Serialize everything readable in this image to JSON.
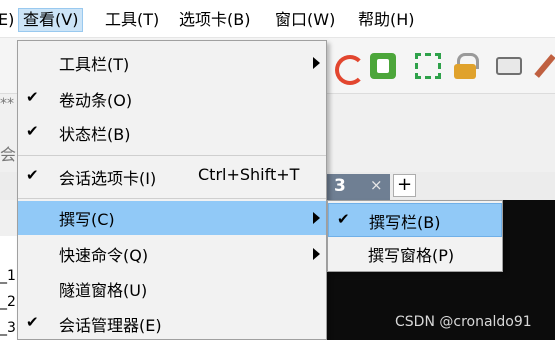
{
  "menubar": {
    "partial_left": "E)",
    "items": [
      {
        "label": "查看(V)",
        "active": true
      },
      {
        "label": "工具(T)"
      },
      {
        "label": "选项卡(B)"
      },
      {
        "label": "窗口(W)"
      },
      {
        "label": "帮助(H)"
      }
    ]
  },
  "toolbar": {
    "icons": [
      "swirl-icon",
      "green-app-icon",
      "fullscreen-icon",
      "lock-icon",
      "keyboard-icon",
      "pen-icon"
    ]
  },
  "background": {
    "frag_stars": "**",
    "frag_session": "会",
    "frag_rows": [
      "_1",
      "_2",
      "_3"
    ],
    "tab_number": "3",
    "tab_close": "×",
    "tab_add": "+"
  },
  "view_menu": {
    "items": [
      {
        "label": "工具栏(T)",
        "checked": false,
        "submenu": true
      },
      {
        "label": "卷动条(O)",
        "checked": true
      },
      {
        "label": "状态栏(B)",
        "checked": true
      },
      {
        "label": "会话选项卡(I)",
        "checked": true,
        "shortcut": "Ctrl+Shift+T"
      },
      {
        "label": "撰写(C)",
        "checked": false,
        "submenu": true,
        "highlighted": true
      },
      {
        "label": "快速命令(Q)",
        "checked": false,
        "submenu": true
      },
      {
        "label": "隧道窗格(U)",
        "checked": false
      },
      {
        "label": "会话管理器(E)",
        "checked": true
      }
    ],
    "check_glyph": "✔"
  },
  "compose_submenu": {
    "items": [
      {
        "label": "撰写栏(B)",
        "checked": true,
        "highlighted": true
      },
      {
        "label": "撰写窗格(P)",
        "checked": false
      }
    ]
  },
  "watermark": "CSDN @cronaldo91",
  "colors": {
    "highlight": "#91c9f7",
    "menubar_active": "#cce4f7",
    "menu_bg": "#f2f2f2",
    "tab_active": "#6f7f93"
  }
}
